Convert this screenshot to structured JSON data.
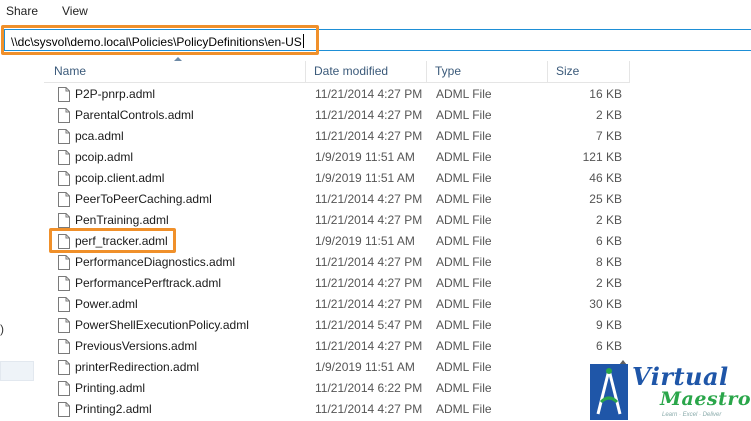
{
  "ribbon": {
    "tabs": [
      "Share",
      "View"
    ]
  },
  "address": {
    "path": "\\\\dc\\sysvol\\demo.local\\Policies\\PolicyDefinitions\\en-US"
  },
  "nav": {
    "partial_text": ")"
  },
  "columns": {
    "name": "Name",
    "date": "Date modified",
    "type": "Type",
    "size": "Size"
  },
  "files": [
    {
      "name": "P2P-pnrp.adml",
      "date": "11/21/2014 4:27 PM",
      "type": "ADML File",
      "size": "16 KB"
    },
    {
      "name": "ParentalControls.adml",
      "date": "11/21/2014 4:27 PM",
      "type": "ADML File",
      "size": "2 KB"
    },
    {
      "name": "pca.adml",
      "date": "11/21/2014 4:27 PM",
      "type": "ADML File",
      "size": "7 KB"
    },
    {
      "name": "pcoip.adml",
      "date": "1/9/2019 11:51 AM",
      "type": "ADML File",
      "size": "121 KB"
    },
    {
      "name": "pcoip.client.adml",
      "date": "1/9/2019 11:51 AM",
      "type": "ADML File",
      "size": "46 KB"
    },
    {
      "name": "PeerToPeerCaching.adml",
      "date": "11/21/2014 4:27 PM",
      "type": "ADML File",
      "size": "25 KB"
    },
    {
      "name": "PenTraining.adml",
      "date": "11/21/2014 4:27 PM",
      "type": "ADML File",
      "size": "2 KB"
    },
    {
      "name": "perf_tracker.adml",
      "date": "1/9/2019 11:51 AM",
      "type": "ADML File",
      "size": "6 KB"
    },
    {
      "name": "PerformanceDiagnostics.adml",
      "date": "11/21/2014 4:27 PM",
      "type": "ADML File",
      "size": "8 KB"
    },
    {
      "name": "PerformancePerftrack.adml",
      "date": "11/21/2014 4:27 PM",
      "type": "ADML File",
      "size": "2 KB"
    },
    {
      "name": "Power.adml",
      "date": "11/21/2014 4:27 PM",
      "type": "ADML File",
      "size": "30 KB"
    },
    {
      "name": "PowerShellExecutionPolicy.adml",
      "date": "11/21/2014 5:47 PM",
      "type": "ADML File",
      "size": "9 KB"
    },
    {
      "name": "PreviousVersions.adml",
      "date": "11/21/2014 4:27 PM",
      "type": "ADML File",
      "size": "6 KB"
    },
    {
      "name": "printerRedirection.adml",
      "date": "1/9/2019 11:51 AM",
      "type": "ADML File",
      "size": ""
    },
    {
      "name": "Printing.adml",
      "date": "11/21/2014 6:22 PM",
      "type": "ADML File",
      "size": ""
    },
    {
      "name": "Printing2.adml",
      "date": "11/21/2014 4:27 PM",
      "type": "ADML File",
      "size": ""
    }
  ],
  "logo": {
    "line1": "Virtual",
    "line2": "Maestro",
    "tagline": "Learn · Excel · Deliver"
  },
  "colors": {
    "highlight": "#f0902a",
    "address_border": "#1e8fd6",
    "logo_blue": "#1f56a8",
    "logo_green": "#2aa64a"
  }
}
